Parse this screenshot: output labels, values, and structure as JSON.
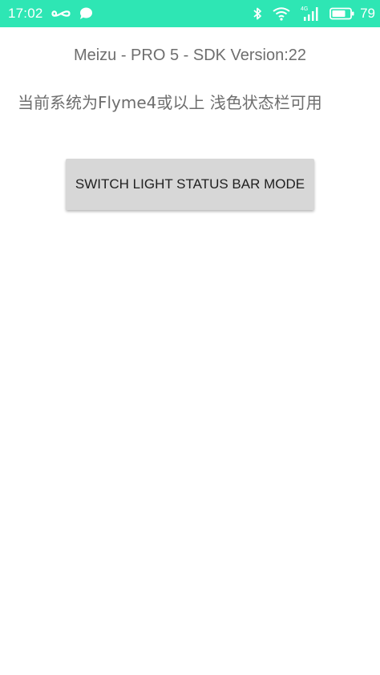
{
  "status_bar": {
    "time": "17:02",
    "battery_percent": "79",
    "network_label": "4G",
    "background_color": "#2ee6b4",
    "icons_left": [
      "infinity-icon",
      "chat-bubble-icon"
    ],
    "icons_right": [
      "bluetooth-icon",
      "wifi-icon",
      "cellular-signal-icon",
      "battery-icon"
    ]
  },
  "main": {
    "device_info": "Meizu - PRO 5 - SDK Version:22",
    "system_message": "当前系统为Flyme4或以上 浅色状态栏可用",
    "switch_button_label": "SWITCH LIGHT STATUS BAR MODE"
  }
}
